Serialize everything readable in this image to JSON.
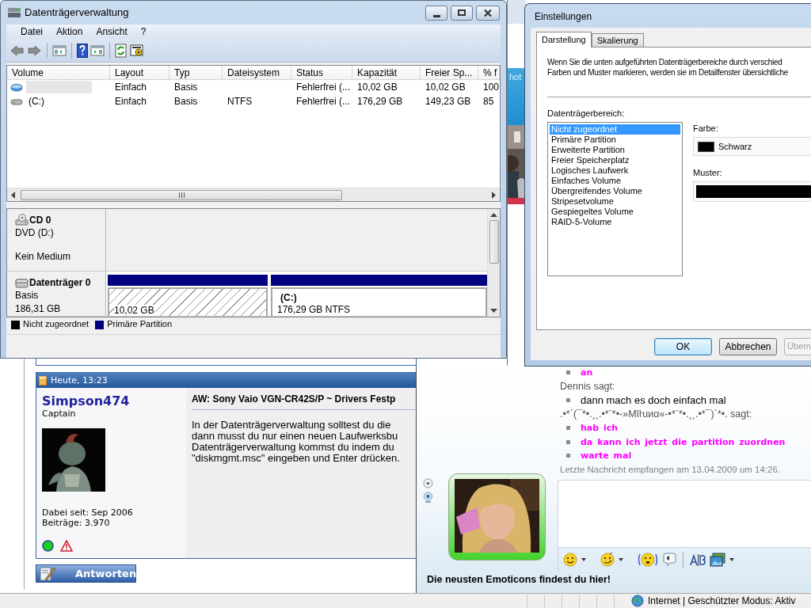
{
  "background_fragment": {
    "text": "hot"
  },
  "disk_window": {
    "title": "Datenträgerverwaltung",
    "menu": [
      "Datei",
      "Aktion",
      "Ansicht",
      "?"
    ],
    "table": {
      "columns": [
        "Volume",
        "Layout",
        "Typ",
        "Dateisystem",
        "Status",
        "Kapazität",
        "Freier Sp...",
        "% f"
      ],
      "rows": [
        {
          "kind": "plain",
          "selected": true,
          "layout": "Einfach",
          "type": "Basis",
          "status": "Fehlerfrei (...",
          "capacity": "10,02 GB",
          "free_space": "10,02 GB",
          "column_8": "100"
        },
        {
          "kind": "system",
          "selected": false,
          "volume": "(C:)",
          "layout": "Einfach",
          "type": "Basis",
          "file_system": "NTFS",
          "status": "Fehlerfrei (...",
          "capacity": "176,29 GB",
          "free_space": "149,23 GB",
          "column_8": "85"
        }
      ]
    },
    "disks": [
      {
        "kind": "cd",
        "name": "CD 0",
        "lines": [
          "DVD (D:)",
          "Kein Medium"
        ]
      },
      {
        "kind": "disk",
        "name": "Datenträger 0",
        "lines": [
          "Basis",
          "186,31 GB"
        ],
        "partitions": [
          {
            "kind": "unallocated",
            "size": "10,02 GB"
          },
          {
            "kind": "primary",
            "label": "(C:)",
            "size": "176,29 GB NTFS"
          }
        ]
      }
    ],
    "legend": [
      {
        "label": "Nicht zugeordnet",
        "color": "#000000"
      },
      {
        "label": "Primäre Partition",
        "color": "#000080"
      }
    ]
  },
  "settings_dialog": {
    "title": "Einstellungen",
    "tabs": [
      {
        "label": "Darstellung",
        "selected": true
      },
      {
        "label": "Skalierung",
        "selected": false
      }
    ],
    "description": [
      "Wenn Sie die unten aufgeführten Datenträgerbereiche durch verschied",
      "Farben und Muster markieren, werden sie im Detailfenster übersichtliche"
    ],
    "area_label": "Datenträgerbereich:",
    "areas": [
      {
        "label": "Nicht zugeordnet",
        "selected": true
      },
      {
        "label": "Primäre Partition",
        "selected": false
      },
      {
        "label": "Erweiterte Partition",
        "selected": false
      },
      {
        "label": "Freier Speicherplatz",
        "selected": false
      },
      {
        "label": "Logisches Laufwerk",
        "selected": false
      },
      {
        "label": "Einfaches Volume",
        "selected": false
      },
      {
        "label": "Übergreifendes Volume",
        "selected": false
      },
      {
        "label": "Stripesetvolume",
        "selected": false
      },
      {
        "label": "Gespiegeltes Volume",
        "selected": false
      },
      {
        "label": "RAID-5-Volume",
        "selected": false
      }
    ],
    "color_label": "Farbe:",
    "color_value": "Schwarz",
    "pattern_label": "Muster:",
    "buttons": [
      {
        "label": "OK",
        "default": true,
        "disabled": false
      },
      {
        "label": "Abbrechen",
        "default": false,
        "disabled": false
      },
      {
        "label": "Übern",
        "default": false,
        "disabled": true
      }
    ]
  },
  "forum_post": {
    "time": "Heute, 13:23",
    "username": "Simpson474",
    "rank": "Captain",
    "joined": "Dabei seit: Sep 2006",
    "posts": "Beiträge: 3.970",
    "online": true,
    "title": "AW: Sony Vaio VGN-CR42S/P ~ Drivers Festp",
    "body": [
      "In der Datenträgerverwaltung solltest du die",
      "dann musst du nur einen neuen Laufwerksbu",
      "Datenträgerverwaltung kommst du indem du",
      "\"diskmgmt.msc\" eingeben und Enter drücken."
    ],
    "reply_button": "Antworten"
  },
  "chat": {
    "entries": [
      {
        "kind": "formatted",
        "text": "an",
        "color": "#ff00ff"
      },
      {
        "kind": "sender",
        "text": "Dennis sagt:"
      },
      {
        "kind": "message",
        "text": "dann mach es doch einfach mal",
        "color": "#000000"
      },
      {
        "kind": "sender",
        "text": ".•*´(¯*•.¸¸.•*¨*•-»Mîŀuиα«-•*¨*•.¸¸.•*¯)´*•. sagt:"
      },
      {
        "kind": "formatted",
        "text": "hab ich",
        "color": "#ff00ff"
      },
      {
        "kind": "formatted",
        "text": "da kann ich jetzt die partition zuordnen",
        "color": "#ff00ff"
      },
      {
        "kind": "formatted",
        "text": "warte mal",
        "color": "#ff00ff"
      }
    ],
    "last_message": "Letzte Nachricht empfangen am 13.04.2009 um 14:26.",
    "footer_link": "Die neusten Emoticons findest du hier!"
  },
  "browser_status": "Internet | Geschützter Modus: Aktiv"
}
